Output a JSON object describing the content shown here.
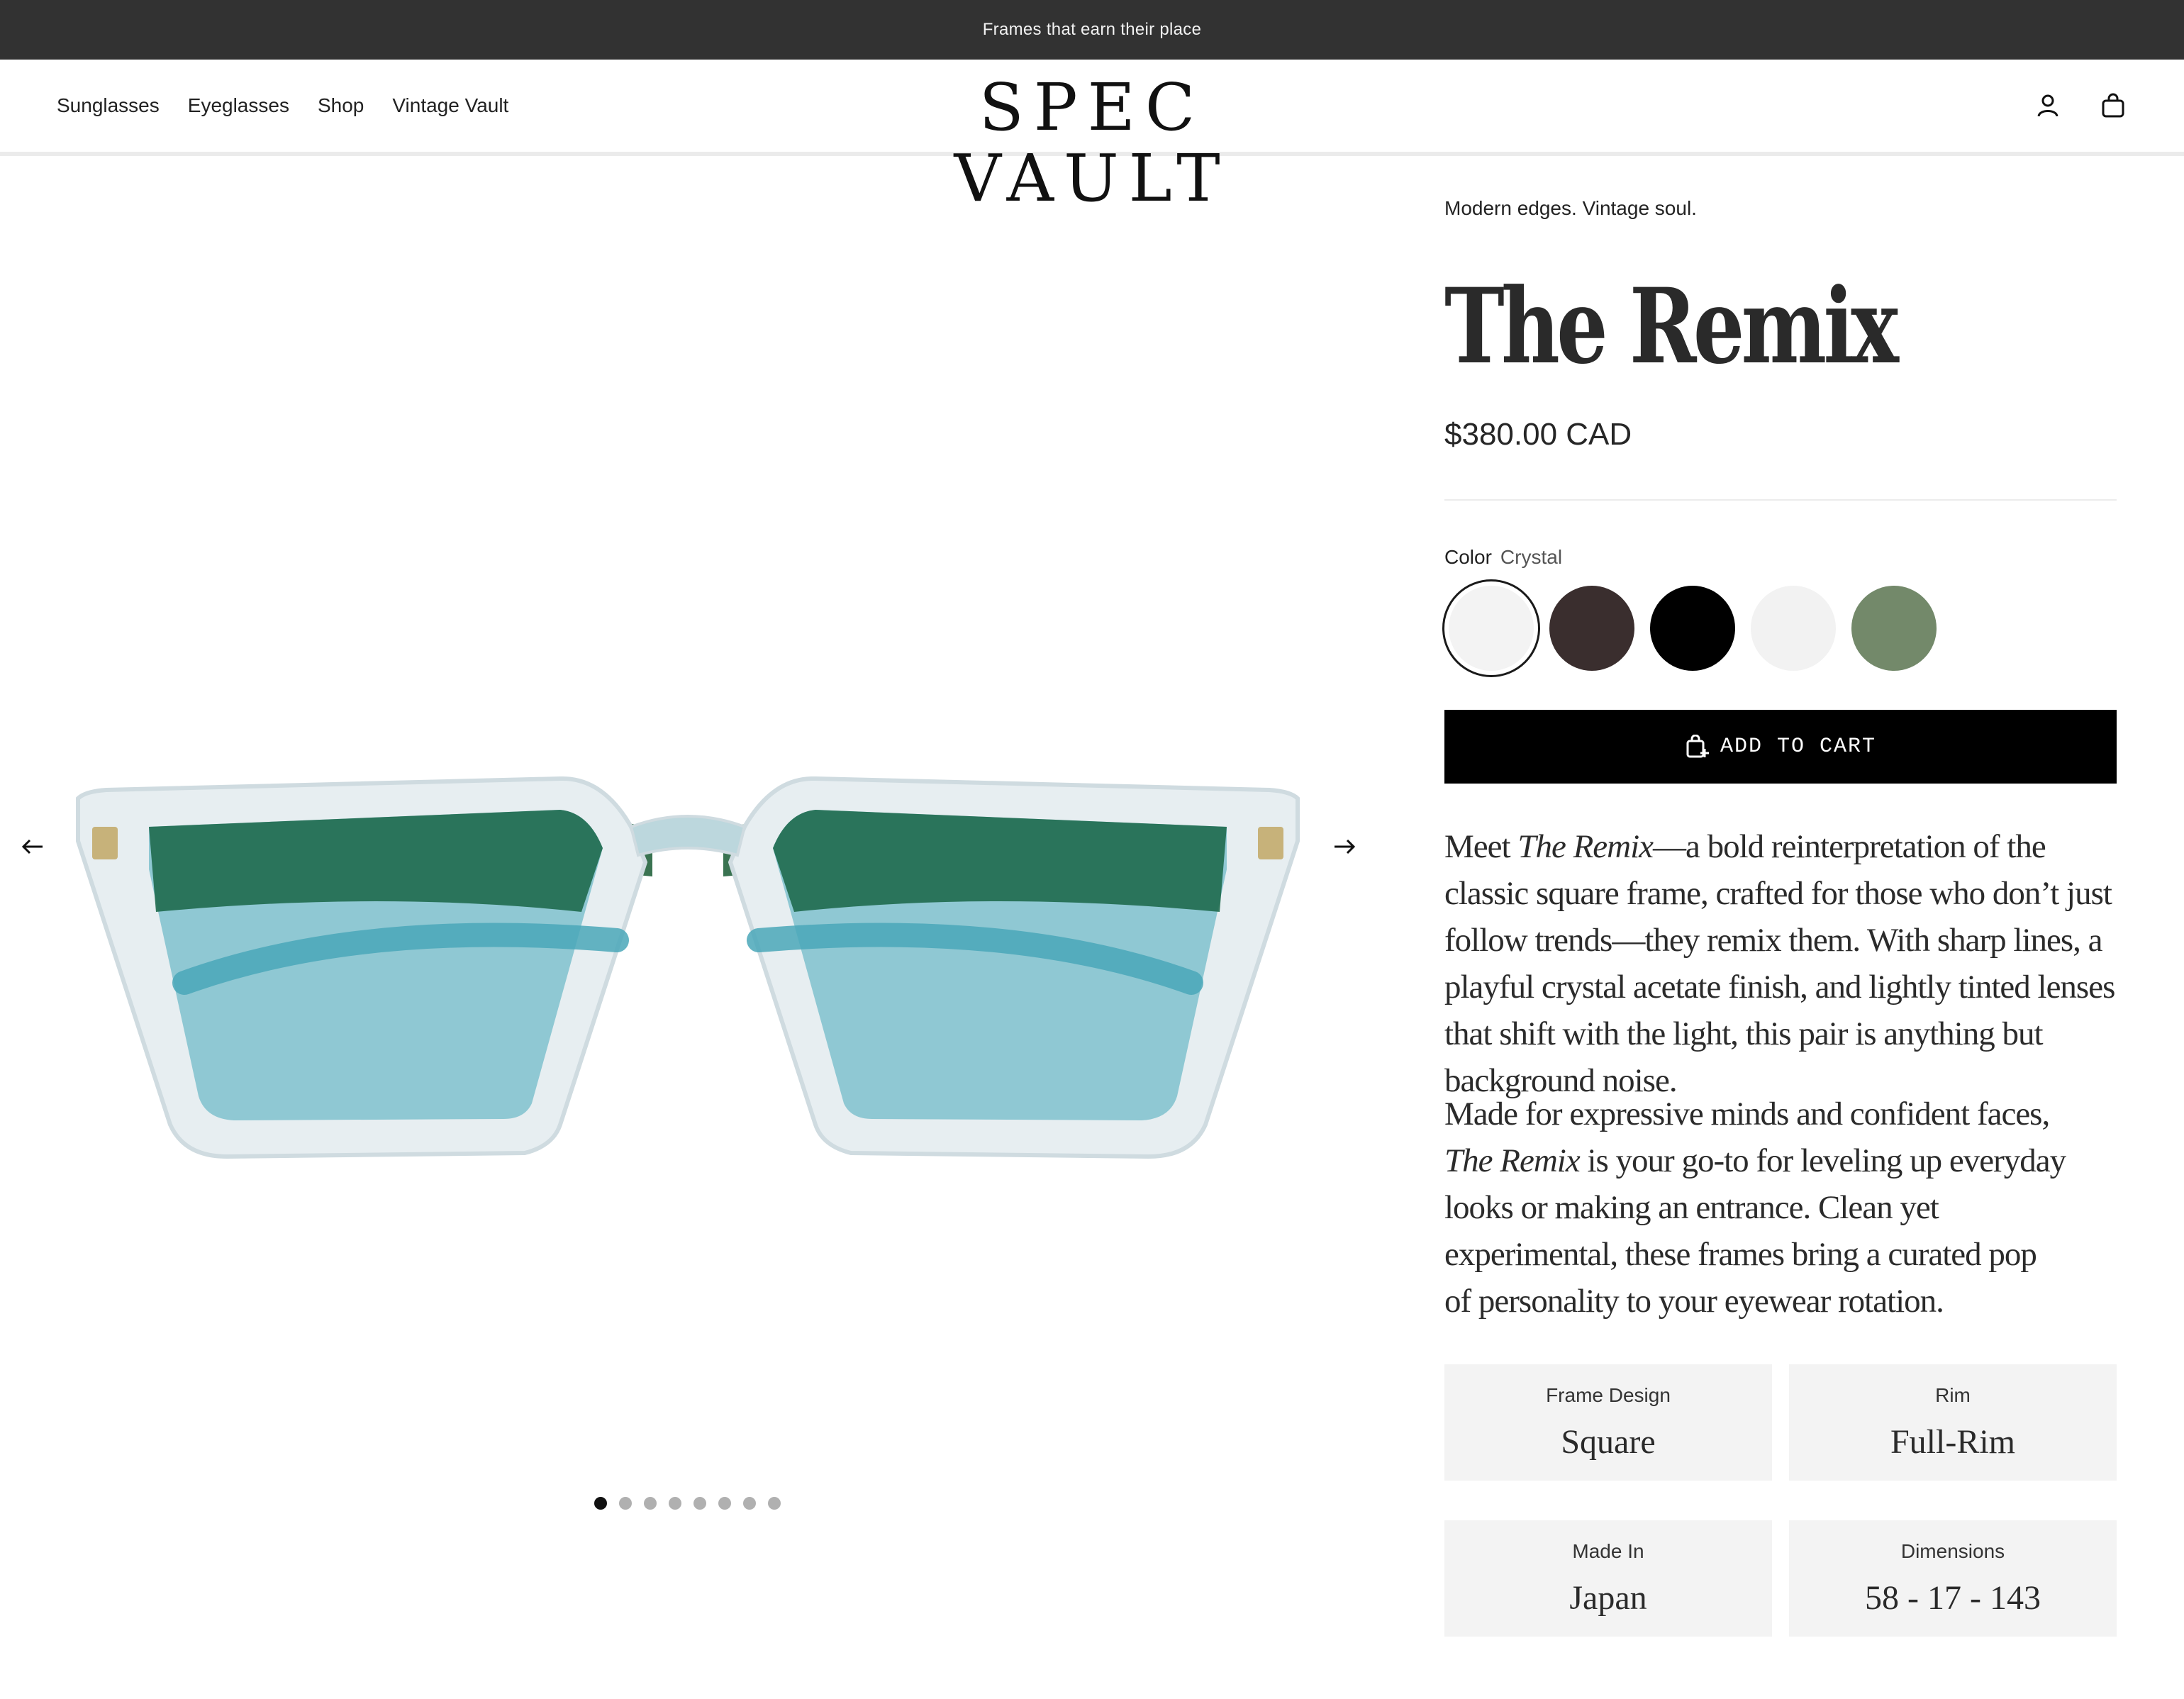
{
  "announcement": "Frames that earn their place",
  "nav": {
    "items": [
      "Sunglasses",
      "Eyeglasses",
      "Shop",
      "Vintage Vault"
    ]
  },
  "brand": {
    "logo": "SPEC VAULT"
  },
  "header_icons": [
    "account-icon",
    "bag-icon"
  ],
  "gallery": {
    "image_alt": "The Remix crystal square sunglasses with blue tinted lenses",
    "dot_count": 8,
    "active_index": 0
  },
  "product": {
    "tagline": "Modern edges. Vintage soul.",
    "title": "The Remix",
    "price": "$380.00 CAD",
    "color_label": "Color",
    "color_value": "Crystal",
    "swatches": [
      {
        "name": "Crystal",
        "color": "#f3f3f3",
        "selected": true
      },
      {
        "name": "Brown",
        "color": "#3a2e2e",
        "selected": false
      },
      {
        "name": "Black",
        "color": "#000000",
        "selected": false
      },
      {
        "name": "Clear",
        "color": "#f2f2f2",
        "selected": false
      },
      {
        "name": "Green",
        "color": "#73896a",
        "selected": false
      }
    ],
    "add_to_cart": "ADD TO CART",
    "description": {
      "p1_meet": "Meet ",
      "p1_name": "The Remix",
      "p1_rest": "—a bold reinterpretation of the classic square frame, crafted for those who don’t just follow trends—they remix them. With sharp lines, a playful crystal acetate finish, and lightly tinted lenses that shift with the light, this pair is anything but background noise.",
      "p2_lead": "Made for expressive minds and confident faces, ",
      "p2_name": "The Remix",
      "p2_rest": " is your go-to for leveling up everyday looks or making an entrance. Clean yet experimental, these frames bring a curated pop of personality to your eyewear rotation."
    },
    "specs": [
      {
        "label": "Frame Design",
        "value": "Square"
      },
      {
        "label": "Rim",
        "value": "Full-Rim"
      },
      {
        "label": "Made In",
        "value": "Japan"
      },
      {
        "label": "Dimensions",
        "value": "58 - 17 - 143"
      }
    ]
  }
}
